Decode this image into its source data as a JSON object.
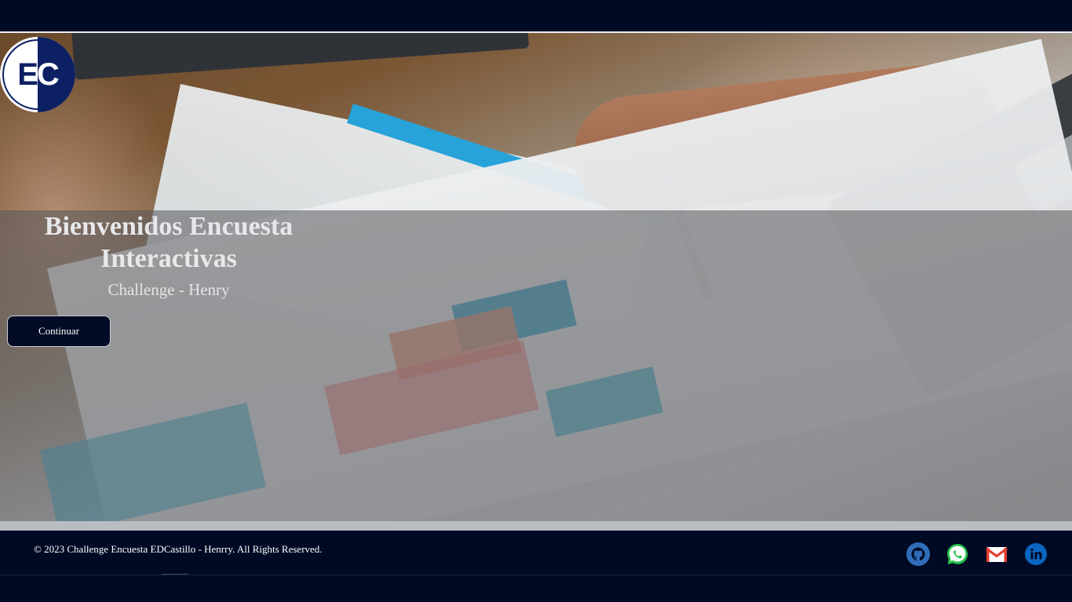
{
  "hero": {
    "title": "Bienvenidos Encuesta Interactivas",
    "subtitle": "Challenge - Henry",
    "button_label": "Continuar"
  },
  "logo": {
    "letter_left": "E",
    "letter_right": "C"
  },
  "footer": {
    "copyright": "© 2023 Challenge Encuesta EDCastillo - Henrry. All Rights Reserved.",
    "social_links": [
      {
        "icon": "github-icon"
      },
      {
        "icon": "whatsapp-icon"
      },
      {
        "icon": "gmail-icon"
      },
      {
        "icon": "linkedin-icon"
      }
    ]
  },
  "colors": {
    "navy": "#010a24",
    "logo_blue": "#0e2064",
    "github_blue": "#2f6db8",
    "whatsapp_green": "#27c24b",
    "gmail_red": "#e53b2e",
    "linkedin_blue": "#0a66c2"
  }
}
